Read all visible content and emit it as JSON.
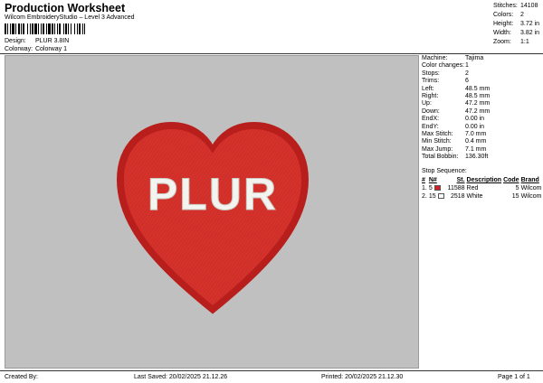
{
  "header": {
    "title": "Production Worksheet",
    "software": "Wilcom EmbroideryStudio – Level 3 Advanced",
    "design_label": "Design:",
    "design_value": "PLUR 3.8IN",
    "colorway_label": "Colorway:",
    "colorway_value": "Colorway 1"
  },
  "stats": [
    {
      "label": "Stitches:",
      "value": "14108"
    },
    {
      "label": "Colors:",
      "value": "2"
    },
    {
      "label": "Height:",
      "value": "3.72 in"
    },
    {
      "label": "Width:",
      "value": "3.82 in"
    },
    {
      "label": "Zoom:",
      "value": "1:1"
    }
  ],
  "design": {
    "text": "PLUR",
    "fill_color": "#d6322c",
    "outline_color": "#b81f1c",
    "text_color": "#f3f3ef"
  },
  "machine_info": [
    {
      "label": "Machine:",
      "value": "Tajima"
    },
    {
      "label": "Color changes:",
      "value": "1"
    },
    {
      "label": "Stops:",
      "value": "2"
    },
    {
      "label": "Trims:",
      "value": "6"
    },
    {
      "label": "Left:",
      "value": "48.5 mm"
    },
    {
      "label": "Right:",
      "value": "48.5 mm"
    },
    {
      "label": "Up:",
      "value": "47.2 mm"
    },
    {
      "label": "Down:",
      "value": "47.2 mm"
    },
    {
      "label": "EndX:",
      "value": "0.00 in"
    },
    {
      "label": "EndY:",
      "value": "0.00 in"
    },
    {
      "label": "Max Stitch:",
      "value": "7.0 mm"
    },
    {
      "label": "Min Stitch:",
      "value": "0.4 mm"
    },
    {
      "label": "Max Jump:",
      "value": "7.1 mm"
    },
    {
      "label": "Total Bobbin:",
      "value": "136.30ft"
    }
  ],
  "stop_sequence": {
    "title": "Stop Sequence:",
    "headers": [
      "#",
      "N#",
      "St.",
      "Description",
      "Code",
      "Brand"
    ],
    "rows": [
      {
        "idx": "1.",
        "n": "5",
        "color": "#d62020",
        "st": "11588",
        "desc": "Red",
        "code": "5",
        "brand": "Wilcom"
      },
      {
        "idx": "2.",
        "n": "15",
        "color": "#ffffff",
        "st": "2518",
        "desc": "White",
        "code": "15",
        "brand": "Wilcom"
      }
    ]
  },
  "footer": {
    "created_by": "Created By:",
    "last_saved": "Last Saved: 20/02/2025 21.12.26",
    "printed": "Printed: 20/02/2025 21.12.30",
    "page": "Page 1 of 1"
  }
}
